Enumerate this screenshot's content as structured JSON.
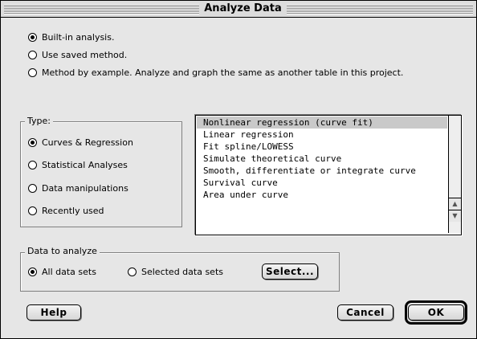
{
  "window": {
    "title": "Analyze Data"
  },
  "mode": {
    "options": [
      {
        "label": "Built-in analysis.",
        "checked": true
      },
      {
        "label": "Use saved method.",
        "checked": false
      },
      {
        "label": "Method by example. Analyze and graph the same as another table in this project.",
        "checked": false
      }
    ]
  },
  "type_group": {
    "label": "Type:",
    "options": [
      {
        "label": "Curves & Regression",
        "checked": true
      },
      {
        "label": "Statistical Analyses",
        "checked": false
      },
      {
        "label": "Data manipulations",
        "checked": false
      },
      {
        "label": "Recently used",
        "checked": false
      }
    ]
  },
  "analysis_list": {
    "items": [
      "Nonlinear regression (curve fit)",
      "Linear regression",
      "Fit spline/LOWESS",
      "Simulate theoretical curve",
      "Smooth, differentiate or integrate curve",
      "Survival curve",
      "Area under curve"
    ],
    "selected_index": 0
  },
  "data_group": {
    "label": "Data to analyze",
    "options": [
      {
        "label": "All data sets",
        "checked": true
      },
      {
        "label": "Selected data sets",
        "checked": false
      }
    ],
    "select_button": "Select..."
  },
  "buttons": {
    "help": "Help",
    "cancel": "Cancel",
    "ok": "OK"
  }
}
